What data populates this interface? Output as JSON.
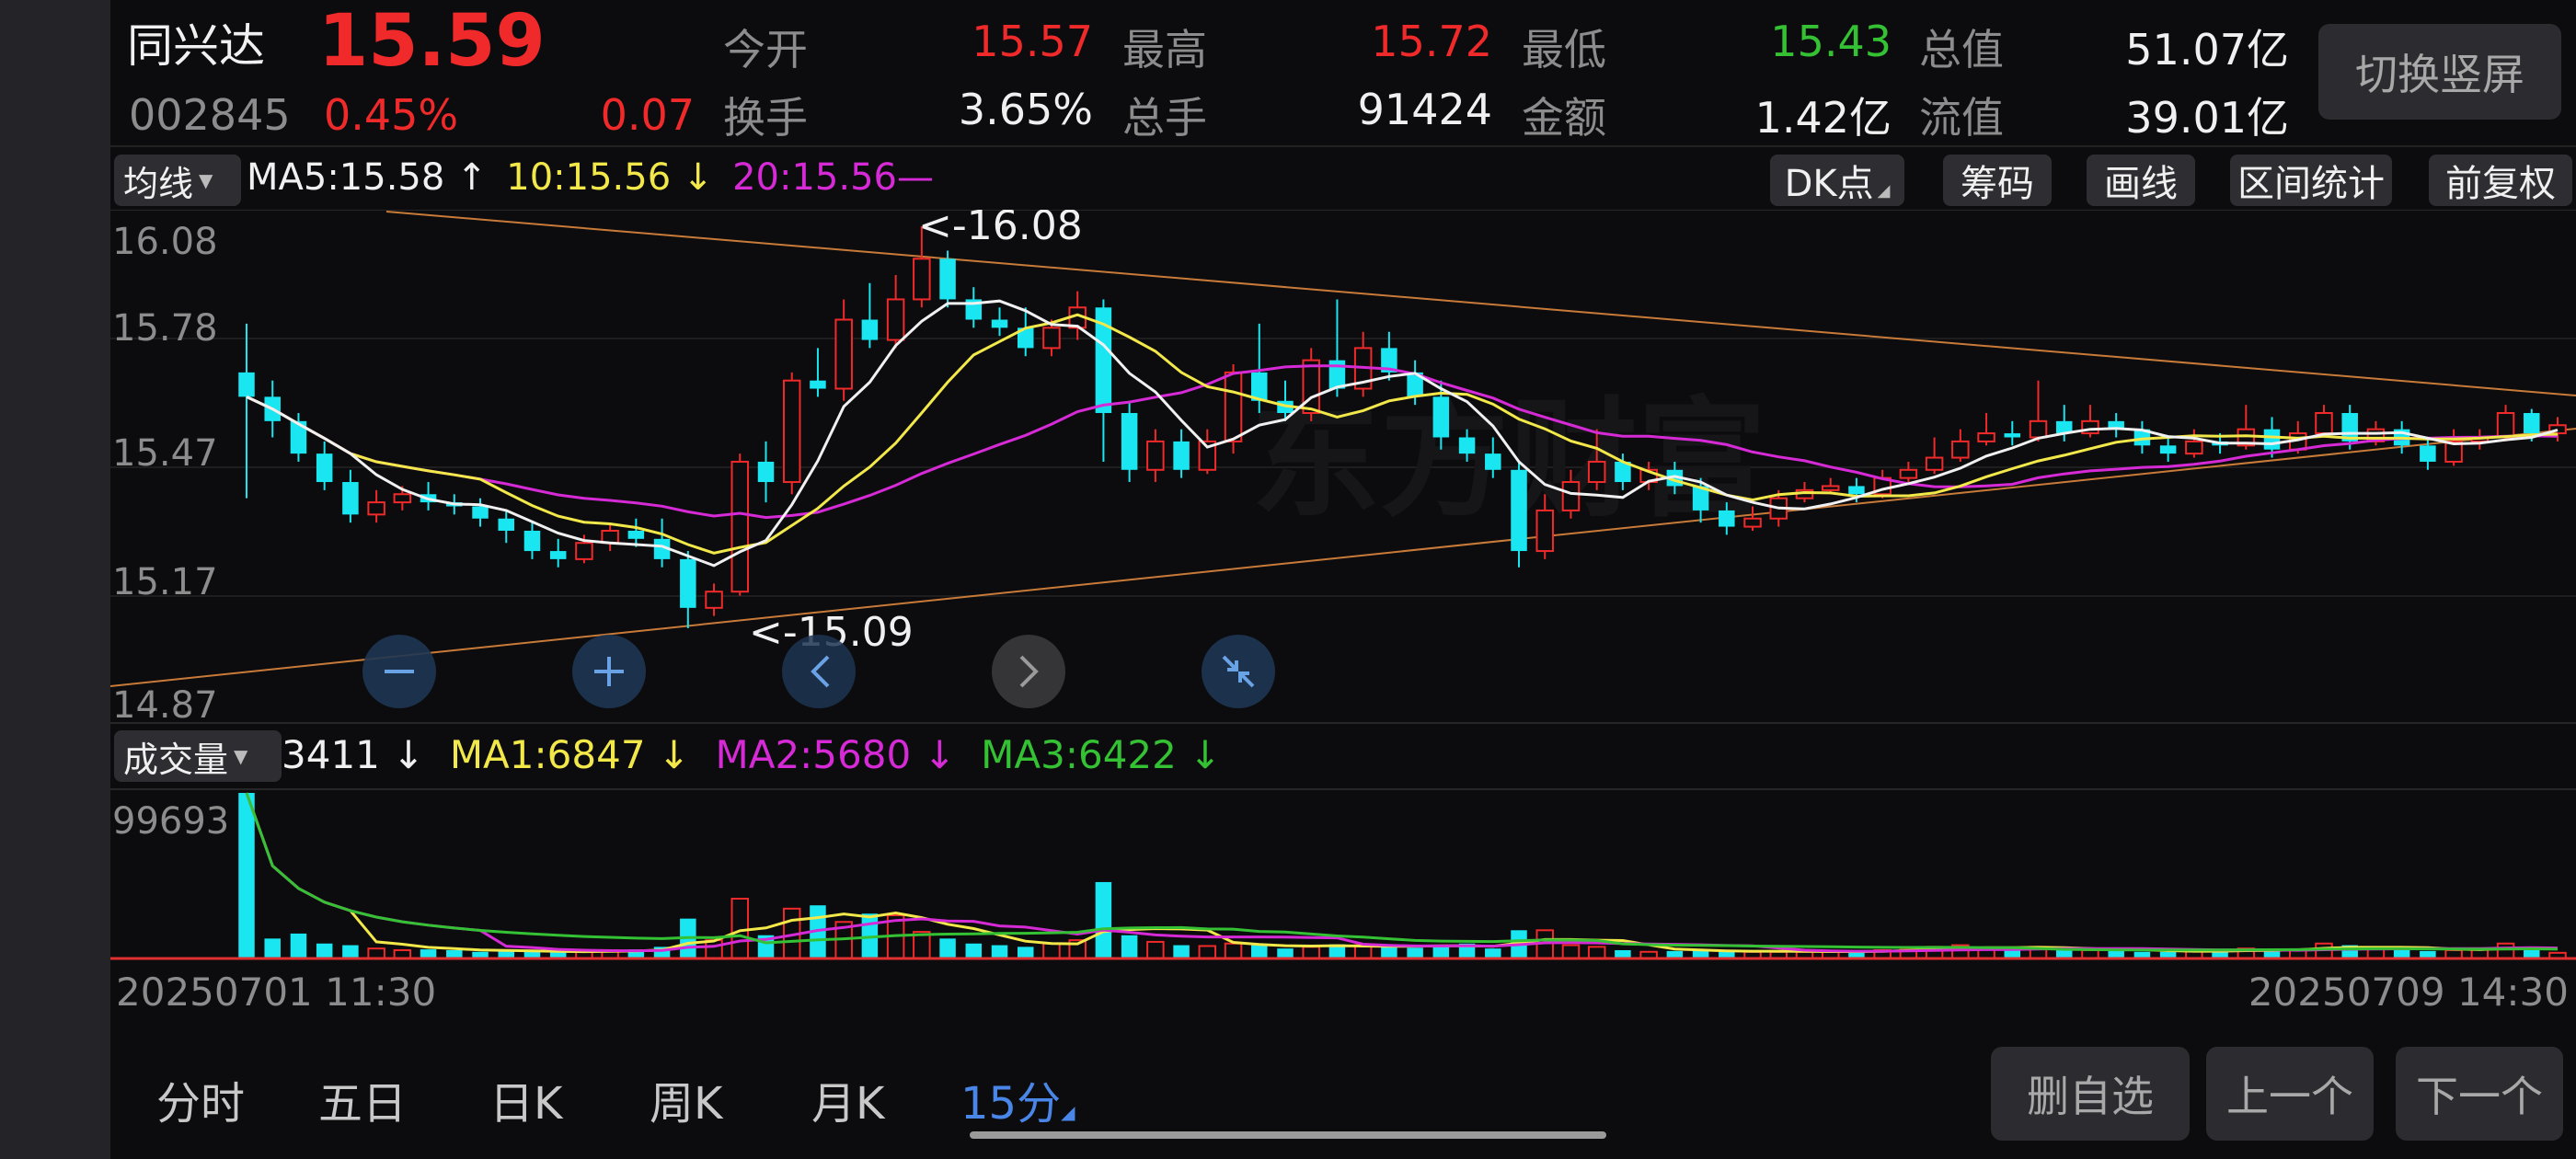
{
  "stock": {
    "name": "同兴达",
    "price": "15.59",
    "code": "002845",
    "change_pct": "0.45%",
    "change": "0.07"
  },
  "quote": {
    "open_label": "今开",
    "open": "15.57",
    "high_label": "最高",
    "high": "15.72",
    "low_label": "最低",
    "low": "15.43",
    "mcap_label": "总值",
    "mcap": "51.07亿",
    "turnover_label": "换手",
    "turnover": "3.65%",
    "volume_label": "总手",
    "volume": "91424",
    "amount_label": "金额",
    "amount": "1.42亿",
    "float_label": "流值",
    "float": "39.01亿"
  },
  "switch_button": "切换竖屏",
  "ma_bar": {
    "selector": "均线",
    "ma5": "MA5:15.58",
    "ma5_arrow": "↑",
    "ma10": "10:15.56",
    "ma10_arrow": "↓",
    "ma20": "20:15.56—"
  },
  "tools": [
    "DK点",
    "筹码",
    "画线",
    "区间统计",
    "前复权"
  ],
  "price_axis": [
    "16.08",
    "15.78",
    "15.47",
    "15.17",
    "14.87"
  ],
  "markers": {
    "high": "<-16.08",
    "low": "<-15.09"
  },
  "vol_bar": {
    "selector": "成交量",
    "vol": "3411",
    "vol_arrow": "↓",
    "ma1": "MA1:6847",
    "ma1_arrow": "↓",
    "ma2": "MA2:5680",
    "ma2_arrow": "↓",
    "ma3": "MA3:6422",
    "ma3_arrow": "↓"
  },
  "vol_axis_max": "99693",
  "time_start": "20250701 11:30",
  "time_end": "20250709 14:30",
  "period_tabs": [
    "分时",
    "五日",
    "日K",
    "周K",
    "月K",
    "15分"
  ],
  "actions": [
    "删自选",
    "上一个",
    "下一个"
  ],
  "colors": {
    "up": "#f02a2a",
    "down": "#19e6f0",
    "ma5": "#f0f0f0",
    "ma10": "#f2e84a",
    "ma20": "#d62ad6",
    "ma3": "#34c234",
    "accent": "#4a86e8"
  },
  "chart_data": {
    "type": "candlestick",
    "interval": "15分",
    "ylim": [
      14.87,
      16.08
    ],
    "high_marker": 16.08,
    "low_marker": 15.09,
    "candles": [
      [
        15.72,
        15.66,
        15.84,
        15.41
      ],
      [
        15.66,
        15.6,
        15.7,
        15.56
      ],
      [
        15.6,
        15.52,
        15.62,
        15.5
      ],
      [
        15.52,
        15.45,
        15.55,
        15.43
      ],
      [
        15.45,
        15.37,
        15.48,
        15.35
      ],
      [
        15.37,
        15.4,
        15.43,
        15.35
      ],
      [
        15.4,
        15.42,
        15.44,
        15.38
      ],
      [
        15.42,
        15.4,
        15.45,
        15.38
      ],
      [
        15.4,
        15.39,
        15.42,
        15.37
      ],
      [
        15.39,
        15.36,
        15.41,
        15.34
      ],
      [
        15.36,
        15.33,
        15.38,
        15.3
      ],
      [
        15.33,
        15.28,
        15.35,
        15.26
      ],
      [
        15.28,
        15.26,
        15.31,
        15.24
      ],
      [
        15.26,
        15.3,
        15.32,
        15.25
      ],
      [
        15.3,
        15.33,
        15.35,
        15.28
      ],
      [
        15.33,
        15.31,
        15.36,
        15.29
      ],
      [
        15.31,
        15.26,
        15.36,
        15.24
      ],
      [
        15.26,
        15.14,
        15.28,
        15.09
      ],
      [
        15.14,
        15.18,
        15.2,
        15.12
      ],
      [
        15.18,
        15.5,
        15.52,
        15.17
      ],
      [
        15.5,
        15.45,
        15.55,
        15.4
      ],
      [
        15.45,
        15.7,
        15.72,
        15.42
      ],
      [
        15.7,
        15.68,
        15.78,
        15.66
      ],
      [
        15.68,
        15.85,
        15.9,
        15.65
      ],
      [
        15.85,
        15.8,
        15.94,
        15.78
      ],
      [
        15.8,
        15.9,
        15.96,
        15.78
      ],
      [
        15.9,
        16.0,
        16.08,
        15.88
      ],
      [
        16.0,
        15.9,
        16.02,
        15.88
      ],
      [
        15.9,
        15.85,
        15.93,
        15.83
      ],
      [
        15.85,
        15.83,
        15.88,
        15.81
      ],
      [
        15.83,
        15.78,
        15.88,
        15.76
      ],
      [
        15.78,
        15.83,
        15.85,
        15.76
      ],
      [
        15.83,
        15.88,
        15.92,
        15.8
      ],
      [
        15.88,
        15.62,
        15.9,
        15.5
      ],
      [
        15.62,
        15.48,
        15.65,
        15.45
      ],
      [
        15.48,
        15.55,
        15.58,
        15.45
      ],
      [
        15.55,
        15.48,
        15.58,
        15.46
      ],
      [
        15.48,
        15.55,
        15.58,
        15.47
      ],
      [
        15.55,
        15.72,
        15.74,
        15.52
      ],
      [
        15.72,
        15.65,
        15.84,
        15.62
      ],
      [
        15.65,
        15.62,
        15.7,
        15.6
      ],
      [
        15.62,
        15.75,
        15.78,
        15.6
      ],
      [
        15.75,
        15.68,
        15.9,
        15.66
      ],
      [
        15.68,
        15.78,
        15.82,
        15.66
      ],
      [
        15.78,
        15.72,
        15.82,
        15.7
      ],
      [
        15.72,
        15.66,
        15.75,
        15.64
      ],
      [
        15.66,
        15.56,
        15.7,
        15.53
      ],
      [
        15.56,
        15.52,
        15.58,
        15.5
      ],
      [
        15.52,
        15.48,
        15.56,
        15.46
      ],
      [
        15.48,
        15.28,
        15.5,
        15.24
      ],
      [
        15.28,
        15.38,
        15.42,
        15.26
      ],
      [
        15.38,
        15.45,
        15.48,
        15.36
      ],
      [
        15.45,
        15.5,
        15.58,
        15.43
      ],
      [
        15.5,
        15.45,
        15.52,
        15.43
      ],
      [
        15.45,
        15.48,
        15.5,
        15.43
      ],
      [
        15.48,
        15.44,
        15.5,
        15.42
      ],
      [
        15.44,
        15.38,
        15.46,
        15.35
      ],
      [
        15.38,
        15.34,
        15.4,
        15.32
      ],
      [
        15.34,
        15.36,
        15.39,
        15.33
      ],
      [
        15.36,
        15.41,
        15.43,
        15.34
      ],
      [
        15.41,
        15.43,
        15.45,
        15.4
      ],
      [
        15.43,
        15.44,
        15.46,
        15.42
      ],
      [
        15.44,
        15.42,
        15.46,
        15.4
      ],
      [
        15.42,
        15.46,
        15.48,
        15.41
      ],
      [
        15.46,
        15.48,
        15.5,
        15.45
      ],
      [
        15.48,
        15.51,
        15.56,
        15.47
      ],
      [
        15.51,
        15.55,
        15.58,
        15.5
      ],
      [
        15.55,
        15.57,
        15.62,
        15.54
      ],
      [
        15.57,
        15.56,
        15.6,
        15.54
      ],
      [
        15.56,
        15.6,
        15.7,
        15.55
      ],
      [
        15.6,
        15.57,
        15.64,
        15.55
      ],
      [
        15.57,
        15.6,
        15.64,
        15.56
      ],
      [
        15.6,
        15.58,
        15.62,
        15.56
      ],
      [
        15.58,
        15.54,
        15.6,
        15.52
      ],
      [
        15.54,
        15.52,
        15.56,
        15.5
      ],
      [
        15.52,
        15.55,
        15.58,
        15.51
      ],
      [
        15.55,
        15.54,
        15.57,
        15.52
      ],
      [
        15.54,
        15.58,
        15.64,
        15.53
      ],
      [
        15.58,
        15.53,
        15.61,
        15.51
      ],
      [
        15.53,
        15.57,
        15.6,
        15.52
      ],
      [
        15.57,
        15.62,
        15.64,
        15.56
      ],
      [
        15.62,
        15.55,
        15.64,
        15.53
      ],
      [
        15.55,
        15.58,
        15.6,
        15.54
      ],
      [
        15.58,
        15.54,
        15.6,
        15.52
      ],
      [
        15.54,
        15.5,
        15.56,
        15.48
      ],
      [
        15.5,
        15.55,
        15.58,
        15.49
      ],
      [
        15.55,
        15.56,
        15.58,
        15.53
      ],
      [
        15.56,
        15.62,
        15.64,
        15.55
      ],
      [
        15.62,
        15.57,
        15.63,
        15.55
      ],
      [
        15.57,
        15.59,
        15.61,
        15.55
      ]
    ],
    "volumes": [
      99693,
      12000,
      15000,
      9000,
      8000,
      6000,
      5000,
      5500,
      5000,
      4000,
      4500,
      4000,
      3800,
      4200,
      5000,
      5500,
      7000,
      24000,
      11000,
      36000,
      14000,
      30000,
      32000,
      22000,
      27000,
      26000,
      16000,
      12000,
      9000,
      8000,
      7000,
      9000,
      11000,
      46000,
      14000,
      10000,
      8000,
      7500,
      9000,
      8000,
      6000,
      7000,
      8500,
      8000,
      7000,
      6500,
      8000,
      9000,
      6000,
      17000,
      17000,
      8000,
      7000,
      5000,
      4000,
      4500,
      5000,
      4500,
      4000,
      4000,
      4000,
      4200,
      4500,
      5000,
      6000,
      7000,
      8000,
      6500,
      5000,
      7000,
      6000,
      5000,
      4500,
      4000,
      4000,
      4500,
      5000,
      6000,
      5000,
      5500,
      9000,
      8000,
      6000,
      5000,
      4500,
      5000,
      6000,
      9000,
      7000,
      3411
    ]
  }
}
